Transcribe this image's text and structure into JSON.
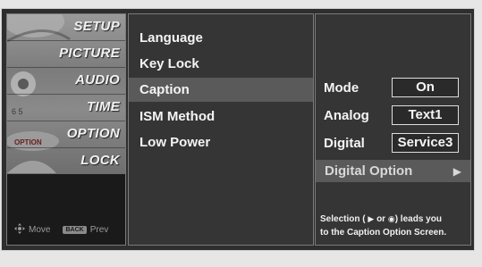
{
  "categories": [
    {
      "label": "SETUP"
    },
    {
      "label": "PICTURE"
    },
    {
      "label": "AUDIO"
    },
    {
      "label": "TIME"
    },
    {
      "label": "OPTION"
    },
    {
      "label": "LOCK"
    }
  ],
  "footer": {
    "move_icon": "dpad-icon",
    "move_label": "Move",
    "back_key": "BACK",
    "prev_label": "Prev"
  },
  "options": [
    {
      "label": "Language"
    },
    {
      "label": "Key Lock"
    },
    {
      "label": "Caption"
    },
    {
      "label": "ISM Method"
    },
    {
      "label": "Low Power"
    }
  ],
  "caption": {
    "mode_label": "Mode",
    "mode_value": "On",
    "analog_label": "Analog",
    "analog_value": "Text1",
    "digital_label": "Digital",
    "digital_value": "Service3",
    "digital_option_label": "Digital Option",
    "digital_option_icon": "▶",
    "help_prefix": "Selection (",
    "help_right_icon": "▶",
    "help_or": "or",
    "help_enter_icon": "◉",
    "help_suffix": ") leads you",
    "help_line2": "to the Caption Option Screen."
  },
  "colors": {
    "panel": "#353535",
    "highlight": "#5a5a5a",
    "text": "#f4f4f4"
  }
}
